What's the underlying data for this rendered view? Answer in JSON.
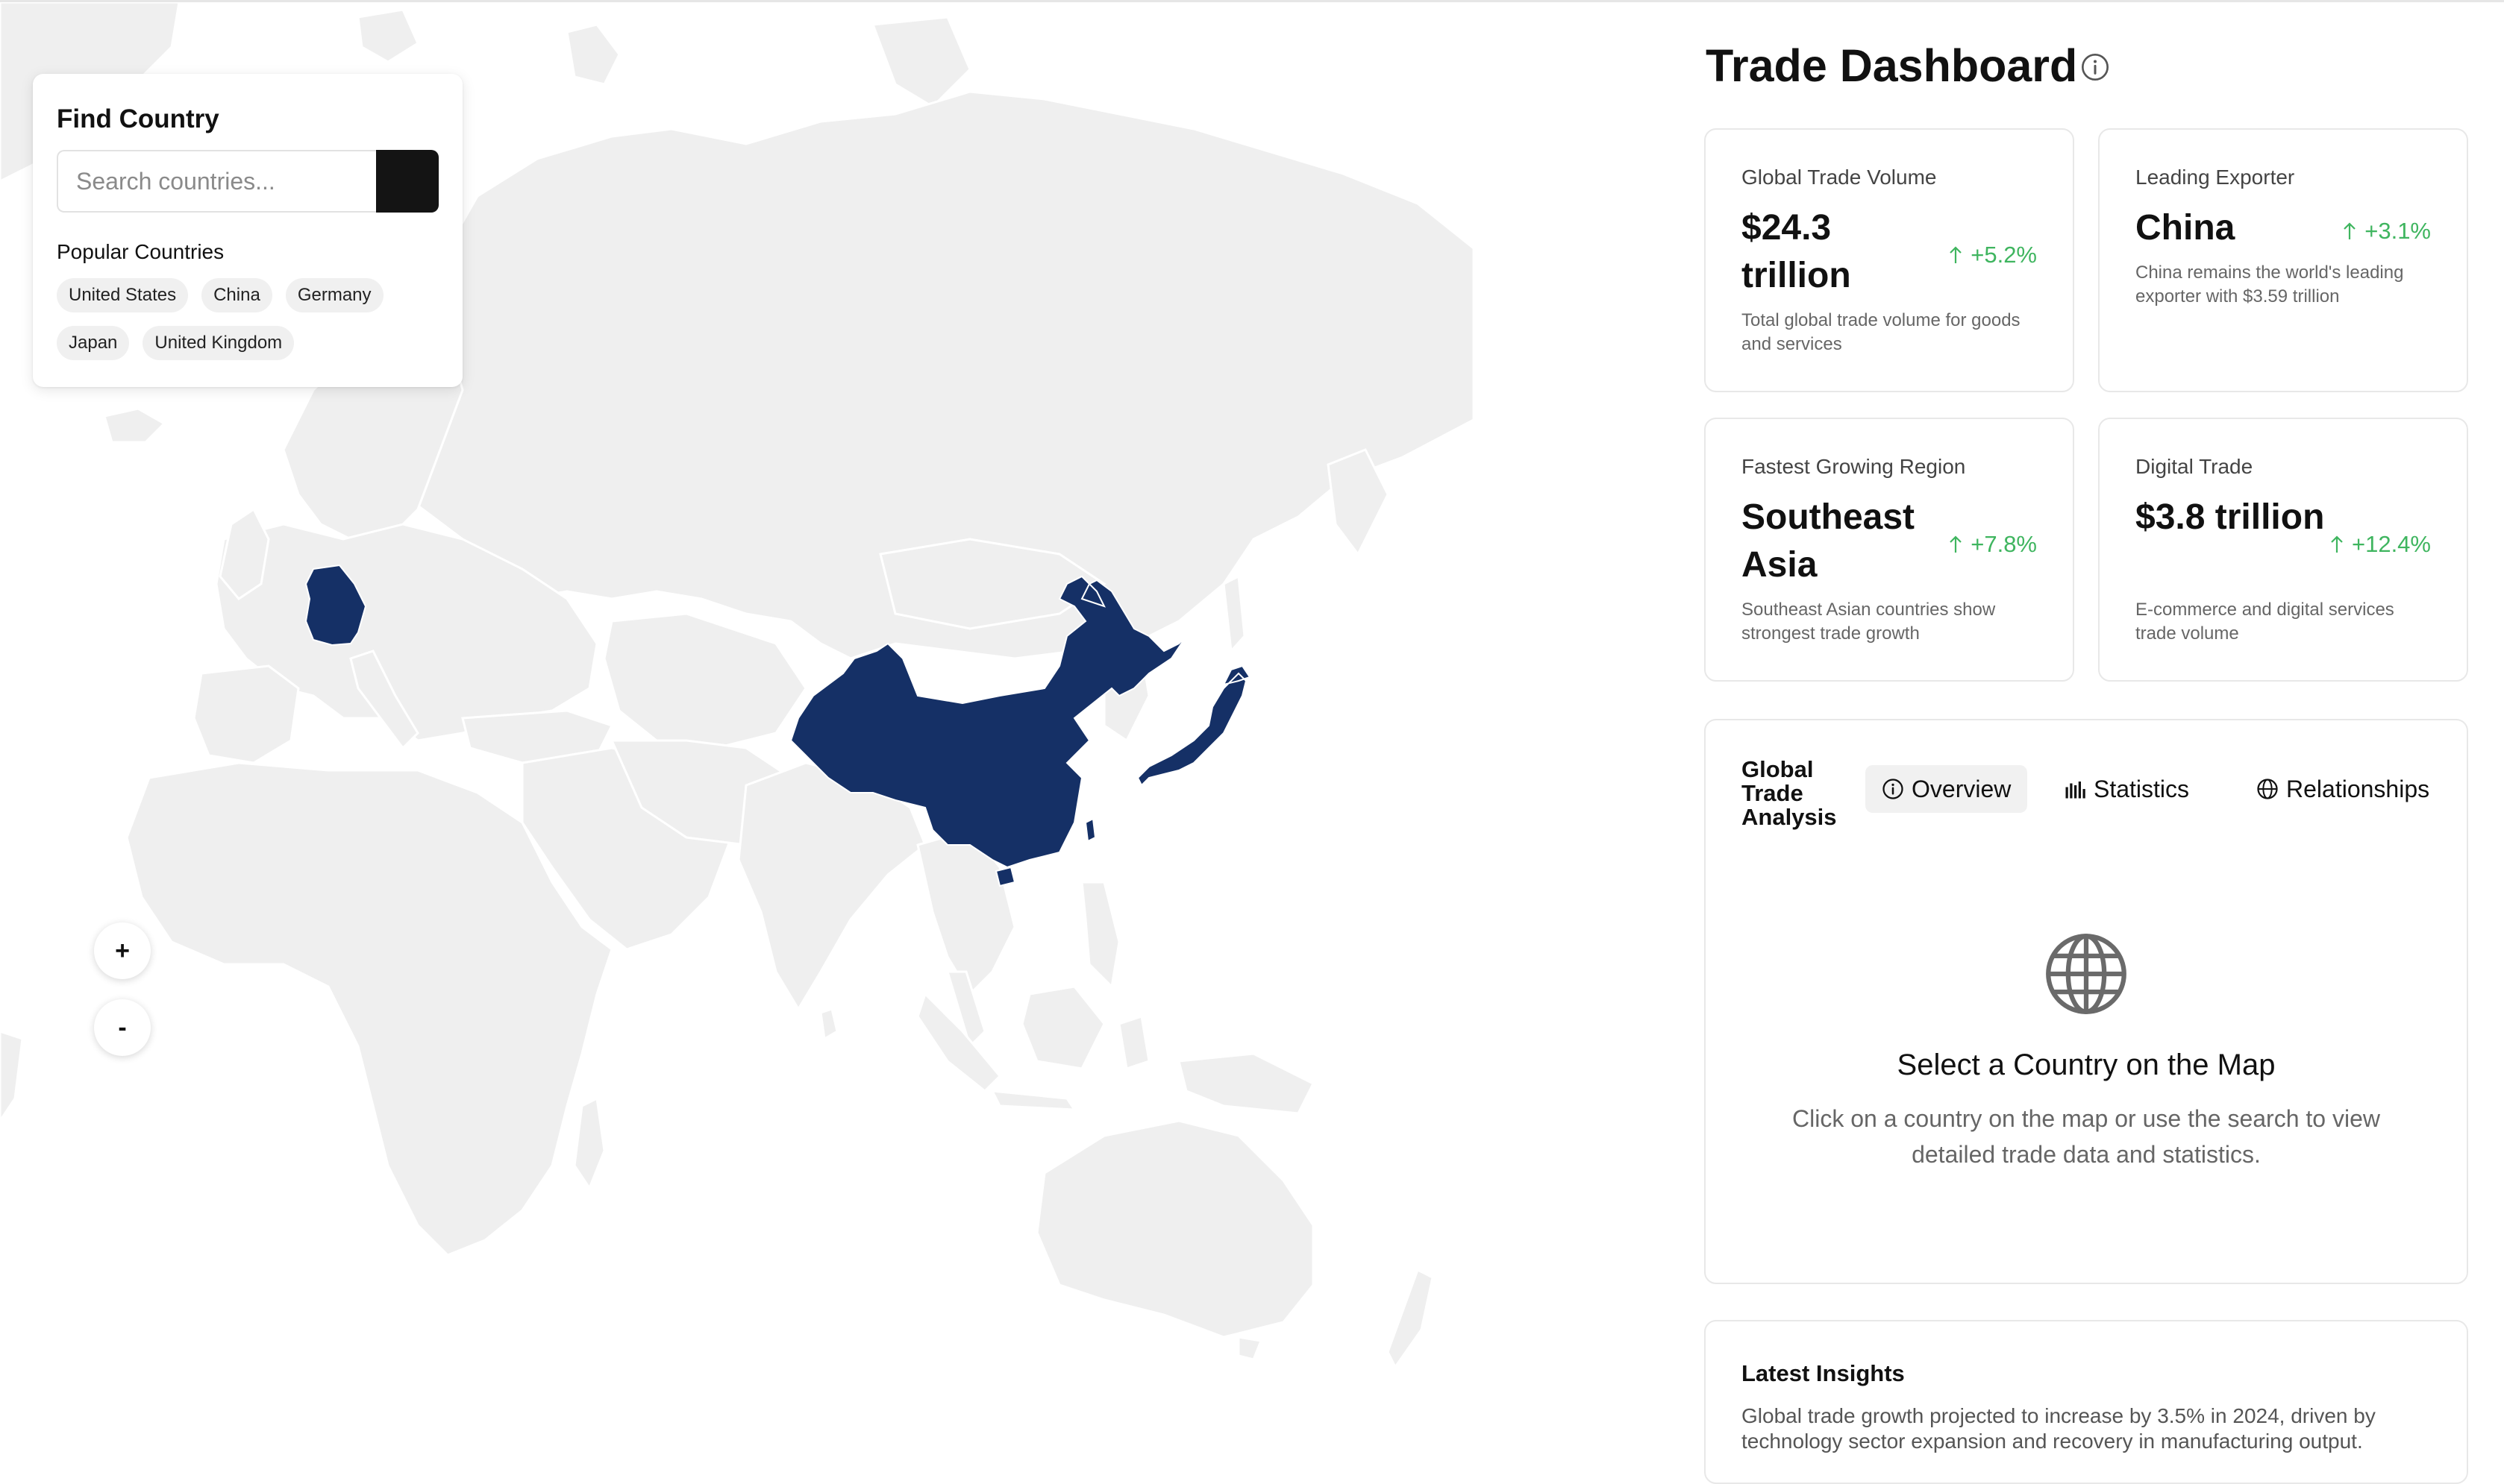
{
  "search": {
    "title": "Find Country",
    "placeholder": "Search countries...",
    "popular_label": "Popular Countries",
    "popular": [
      "United States",
      "China",
      "Germany",
      "Japan",
      "United Kingdom"
    ]
  },
  "map": {
    "highlighted_countries": [
      "China",
      "Germany",
      "Japan"
    ],
    "highlight_color": "#153066",
    "land_color": "#efefef",
    "zoom_in_label": "+",
    "zoom_out_label": "-"
  },
  "dashboard": {
    "title": "Trade Dashboard",
    "cards": [
      {
        "label": "Global Trade Volume",
        "value": "$24.3 trillion",
        "change": "+5.2%",
        "desc": "Total global trade volume for goods and services"
      },
      {
        "label": "Leading Exporter",
        "value": "China",
        "change": "+3.1%",
        "desc": "China remains the world's leading exporter with $3.59 trillion"
      },
      {
        "label": "Fastest Growing Region",
        "value": "Southeast Asia",
        "change": "+7.8%",
        "desc": "Southeast Asian countries show strongest trade growth"
      },
      {
        "label": "Digital Trade",
        "value": "$3.8 trillion",
        "change": "+12.4%",
        "desc": "E-commerce and digital services trade volume"
      }
    ],
    "positive_color": "#3fb55f"
  },
  "analysis": {
    "title": "Global Trade Analysis",
    "tabs": [
      {
        "label": "Overview",
        "icon": "info-icon",
        "active": true
      },
      {
        "label": "Statistics",
        "icon": "bar-chart-icon",
        "active": false
      },
      {
        "label": "Relationships",
        "icon": "globe-icon",
        "active": false
      }
    ],
    "empty_title": "Select a Country on the Map",
    "empty_desc": "Click on a country on the map or use the search to view detailed trade data and statistics."
  },
  "insights": {
    "title": "Latest Insights",
    "text": "Global trade growth projected to increase by 3.5% in 2024, driven by technology sector expansion and recovery in manufacturing output."
  }
}
